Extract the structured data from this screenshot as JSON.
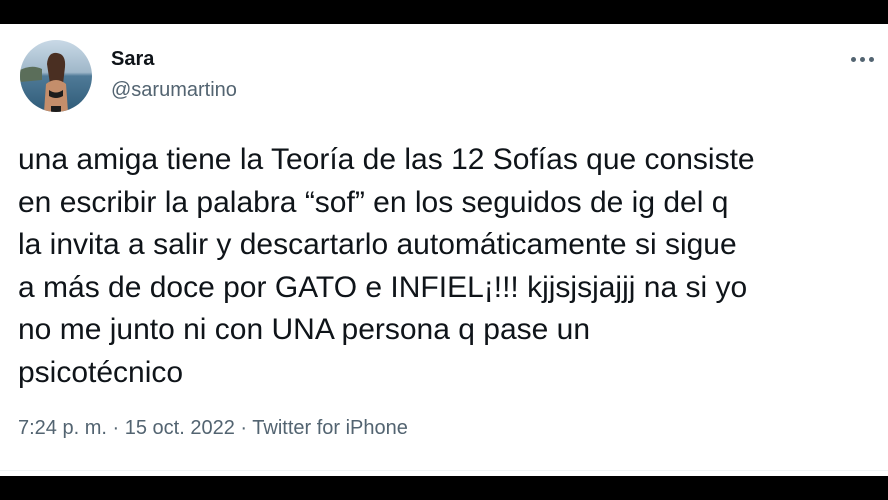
{
  "tweet": {
    "author": {
      "name": "Sara",
      "handle": "@sarumartino"
    },
    "text_lines": [
      "una amiga tiene la Teoría de las 12 Sofías que consiste",
      "en escribir la palabra “sof” en los seguidos de ig del q",
      "la invita a salir y descartarlo automáticamente si sigue",
      "a más de doce por GATO e INFIEL¡!!! kjjsjsjajjj na si yo",
      "no me junto ni con UNA persona q pase un",
      "psicotécnico"
    ],
    "time": "7:24 p. m.",
    "separator": "·",
    "date": "15 oct. 2022",
    "source": "Twitter for iPhone"
  },
  "icons": {
    "more": "more-horizontal-icon"
  },
  "colors": {
    "text_primary": "#0f1419",
    "text_secondary": "#536471",
    "background": "#ffffff",
    "frame": "#000000"
  }
}
